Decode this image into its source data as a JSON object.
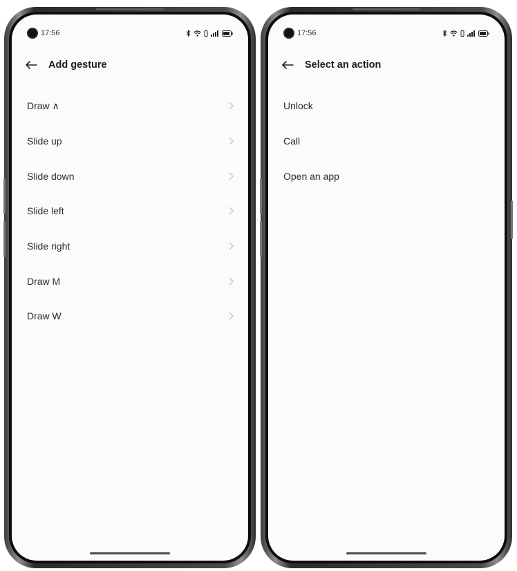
{
  "screens": [
    {
      "status": {
        "time": "17:56"
      },
      "header": {
        "title": "Add gesture",
        "back_icon": "arrow-left-icon"
      },
      "items": [
        {
          "label": "Draw ∧",
          "chevron": true
        },
        {
          "label": "Slide up",
          "chevron": true
        },
        {
          "label": "Slide down",
          "chevron": true
        },
        {
          "label": "Slide left",
          "chevron": true
        },
        {
          "label": "Slide right",
          "chevron": true
        },
        {
          "label": "Draw M",
          "chevron": true
        },
        {
          "label": "Draw W",
          "chevron": true
        }
      ]
    },
    {
      "status": {
        "time": "17:56"
      },
      "header": {
        "title": "Select an action",
        "back_icon": "arrow-left-icon"
      },
      "items": [
        {
          "label": "Unlock",
          "chevron": false
        },
        {
          "label": "Call",
          "chevron": false
        },
        {
          "label": "Open an app",
          "chevron": false
        }
      ]
    }
  ],
  "colors": {
    "screen_bg": "#fbfbfb",
    "text": "#2b2b2b",
    "chevron": "#c4c4c4",
    "frame": "#0d0d0d"
  }
}
